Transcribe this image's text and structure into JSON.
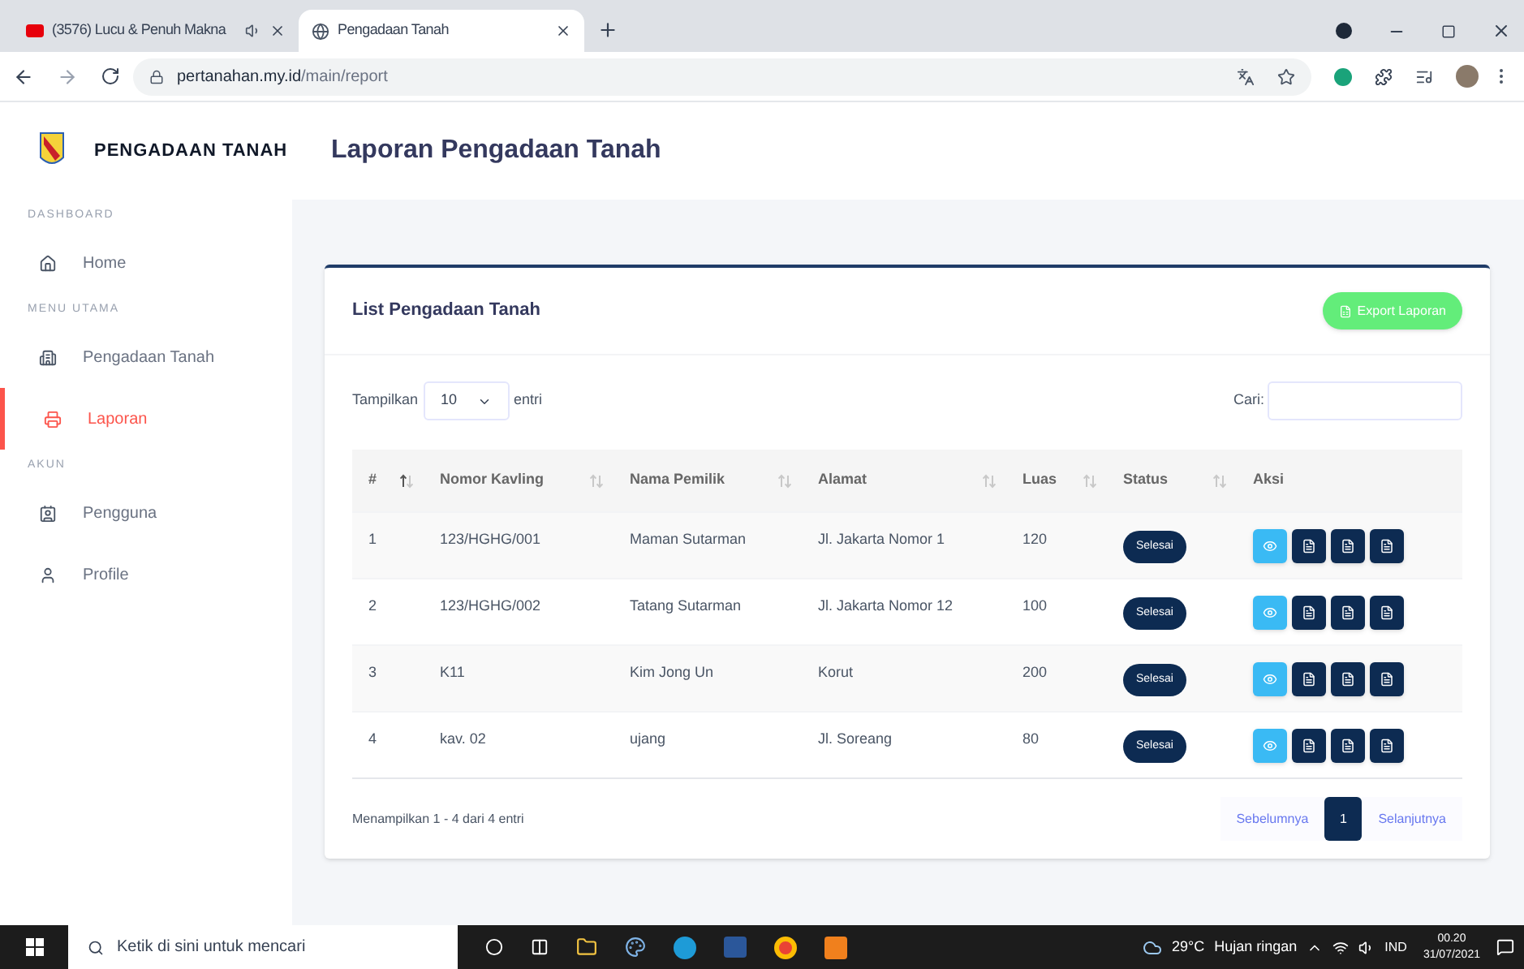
{
  "browser": {
    "tabs": [
      {
        "kind": "video",
        "title": "(3576) Lucu & Penuh Makna",
        "selected": false
      },
      {
        "kind": "globe",
        "title": "Pengadaan Tanah",
        "selected": true
      }
    ],
    "url_host": "pertanahan.my.id",
    "url_path": "/main/report"
  },
  "sidebar": {
    "brand": "PENGADAAN TANAH",
    "sections": [
      {
        "heading": "DASHBOARD",
        "items": [
          {
            "kind": "home",
            "label": "Home",
            "selected": false
          }
        ]
      },
      {
        "heading": "MENU UTAMA",
        "items": [
          {
            "kind": "building",
            "label": "Pengadaan Tanah",
            "selected": false
          },
          {
            "kind": "printer",
            "label": "Laporan",
            "selected": true
          }
        ]
      },
      {
        "heading": "AKUN",
        "items": [
          {
            "kind": "contact",
            "label": "Pengguna",
            "selected": false
          },
          {
            "kind": "user",
            "label": "Profile",
            "selected": false
          }
        ]
      }
    ]
  },
  "page_title": "Laporan Pengadaan Tanah",
  "card": {
    "title": "List Pengadaan Tanah",
    "export_button": "Export Laporan",
    "length": {
      "label": "Tampilkan",
      "value": "10",
      "suffix": "entri"
    },
    "search_label": "Cari:",
    "columns": [
      {
        "label": "#",
        "sorted": true
      },
      {
        "label": "Nomor Kavling",
        "sorted": false
      },
      {
        "label": "Nama Pemilik",
        "sorted": false
      },
      {
        "label": "Alamat",
        "sorted": false
      },
      {
        "label": "Luas",
        "sorted": false
      },
      {
        "label": "Status",
        "sorted": false
      },
      {
        "label": "Aksi"
      }
    ],
    "rows": [
      {
        "cells": [
          "1",
          "123/HGHG/001",
          "Maman Sutarman",
          "Jl. Jakarta Nomor 1",
          "120"
        ],
        "status": "Selesai"
      },
      {
        "cells": [
          "2",
          "123/HGHG/002",
          "Tatang Sutarman",
          "Jl. Jakarta Nomor 12",
          "100"
        ],
        "status": "Selesai"
      },
      {
        "cells": [
          "3",
          "K11",
          "Kim Jong Un",
          "Korut",
          "200"
        ],
        "status": "Selesai"
      },
      {
        "cells": [
          "4",
          "kav. 02",
          "ujang",
          "Jl. Soreang",
          "80"
        ],
        "status": "Selesai"
      }
    ],
    "info": "Menampilkan 1 - 4 dari 4 entri",
    "pagination": {
      "previous": "Sebelumnya",
      "pages": [
        {
          "label": "1",
          "selected": true
        }
      ],
      "next": "Selanjutnya"
    }
  },
  "taskbar": {
    "search_placeholder": "Ketik di sini untuk mencari",
    "temperature": "29°C",
    "weather": "Hujan ringan",
    "language": "IND",
    "time": "00.20",
    "date": "31/07/2021"
  }
}
